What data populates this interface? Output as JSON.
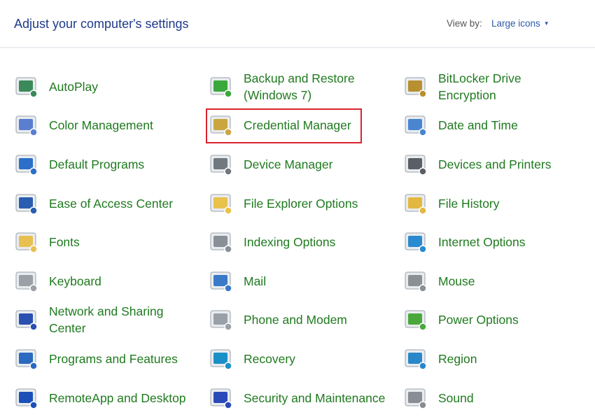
{
  "header": {
    "title": "Adjust your computer's settings",
    "view_by_label": "View by:",
    "view_by_value": "Large icons"
  },
  "highlight_color": "#d9232e",
  "items": [
    {
      "label": "AutoPlay",
      "icon": "autoplay-icon",
      "color": "#3b8a5a"
    },
    {
      "label": "Backup and Restore (Windows 7)",
      "icon": "backup-restore-icon",
      "color": "#3aa83a"
    },
    {
      "label": "BitLocker Drive Encryption",
      "icon": "bitlocker-icon",
      "color": "#b89030"
    },
    {
      "label": "Color Management",
      "icon": "color-management-icon",
      "color": "#5a7fd0"
    },
    {
      "label": "Credential Manager",
      "icon": "credential-manager-icon",
      "color": "#c9a640"
    },
    {
      "label": "Date and Time",
      "icon": "date-time-icon",
      "color": "#4a86d0"
    },
    {
      "label": "Default Programs",
      "icon": "default-programs-icon",
      "color": "#2a70c8"
    },
    {
      "label": "Device Manager",
      "icon": "device-manager-icon",
      "color": "#707880"
    },
    {
      "label": "Devices and Printers",
      "icon": "devices-printers-icon",
      "color": "#5a5f66"
    },
    {
      "label": "Ease of Access Center",
      "icon": "ease-of-access-icon",
      "color": "#2a5db0"
    },
    {
      "label": "File Explorer Options",
      "icon": "file-explorer-options-icon",
      "color": "#e8c24a"
    },
    {
      "label": "File History",
      "icon": "file-history-icon",
      "color": "#e2b840"
    },
    {
      "label": "Fonts",
      "icon": "fonts-icon",
      "color": "#e8c050"
    },
    {
      "label": "Indexing Options",
      "icon": "indexing-options-icon",
      "color": "#8a9098"
    },
    {
      "label": "Internet Options",
      "icon": "internet-options-icon",
      "color": "#2a8ad0"
    },
    {
      "label": "Keyboard",
      "icon": "keyboard-icon",
      "color": "#9aa0a6"
    },
    {
      "label": "Mail",
      "icon": "mail-icon",
      "color": "#3a7ac8"
    },
    {
      "label": "Mouse",
      "icon": "mouse-icon",
      "color": "#8a9096"
    },
    {
      "label": "Network and Sharing Center",
      "icon": "network-sharing-icon",
      "color": "#2a50b0"
    },
    {
      "label": "Phone and Modem",
      "icon": "phone-modem-icon",
      "color": "#9aa0a8"
    },
    {
      "label": "Power Options",
      "icon": "power-options-icon",
      "color": "#4aa83a"
    },
    {
      "label": "Programs and Features",
      "icon": "programs-features-icon",
      "color": "#2a6ac0"
    },
    {
      "label": "Recovery",
      "icon": "recovery-icon",
      "color": "#1a90c8"
    },
    {
      "label": "Region",
      "icon": "region-icon",
      "color": "#2a88c8"
    },
    {
      "label": "RemoteApp and Desktop",
      "icon": "remoteapp-icon",
      "color": "#1a50b8"
    },
    {
      "label": "Security and Maintenance",
      "icon": "security-maintenance-icon",
      "color": "#2a4ab8"
    },
    {
      "label": "Sound",
      "icon": "sound-icon",
      "color": "#8a8e94"
    }
  ]
}
